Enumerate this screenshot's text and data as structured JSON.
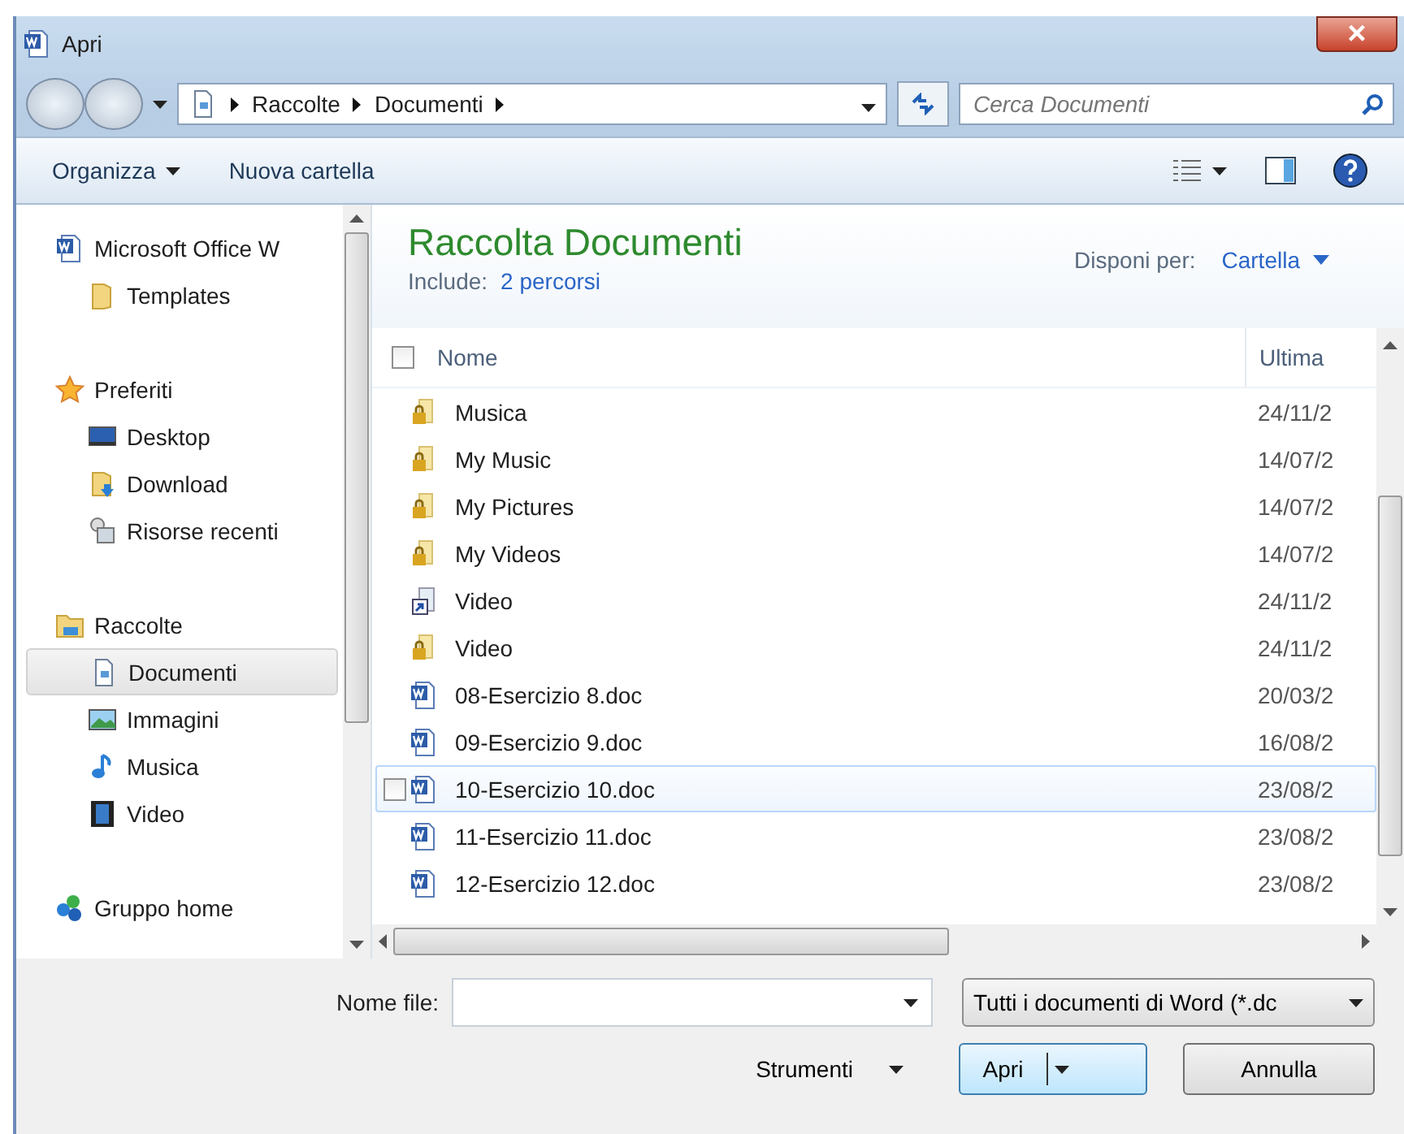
{
  "window": {
    "title": "Apri",
    "close": "×"
  },
  "address": {
    "crumbs": [
      "Raccolte",
      "Documenti"
    ],
    "search_placeholder": "Cerca Documenti"
  },
  "toolbar": {
    "organize": "Organizza",
    "new_folder": "Nuova cartella"
  },
  "sidebar": {
    "groups": [
      {
        "label": "Microsoft Office W",
        "kind": "word",
        "children": [
          {
            "label": "Templates",
            "kind": "folder",
            "selected": false
          }
        ]
      },
      {
        "label": "Preferiti",
        "kind": "star",
        "children": [
          {
            "label": "Desktop",
            "kind": "desktop",
            "selected": false
          },
          {
            "label": "Download",
            "kind": "download",
            "selected": false
          },
          {
            "label": "Risorse recenti",
            "kind": "recent",
            "selected": false
          }
        ]
      },
      {
        "label": "Raccolte",
        "kind": "library",
        "children": [
          {
            "label": "Documenti",
            "kind": "doc",
            "selected": true
          },
          {
            "label": "Immagini",
            "kind": "image",
            "selected": false
          },
          {
            "label": "Musica",
            "kind": "music",
            "selected": false
          },
          {
            "label": "Video",
            "kind": "video",
            "selected": false
          }
        ]
      },
      {
        "label": "Gruppo home",
        "kind": "homegroup"
      }
    ]
  },
  "library": {
    "title": "Raccolta Documenti",
    "include_label": "Include:",
    "include_link": "2 percorsi",
    "arrange_label": "Disponi per:",
    "arrange_value": "Cartella"
  },
  "table": {
    "columns": [
      "Nome",
      "Ultima"
    ],
    "all_checked": false,
    "rows": [
      {
        "name": "Musica",
        "date": "24/11/2",
        "kind": "locked-folder",
        "hover": false
      },
      {
        "name": "My Music",
        "date": "14/07/2",
        "kind": "locked-folder",
        "hover": false
      },
      {
        "name": "My Pictures",
        "date": "14/07/2",
        "kind": "locked-folder",
        "hover": false
      },
      {
        "name": "My Videos",
        "date": "14/07/2",
        "kind": "locked-folder",
        "hover": false
      },
      {
        "name": "Video",
        "date": "24/11/2",
        "kind": "shortcut",
        "hover": false
      },
      {
        "name": "Video",
        "date": "24/11/2",
        "kind": "locked-folder",
        "hover": false
      },
      {
        "name": "08-Esercizio 8.doc",
        "date": "20/03/2",
        "kind": "word",
        "hover": false
      },
      {
        "name": "09-Esercizio 9.doc",
        "date": "16/08/2",
        "kind": "word",
        "hover": false
      },
      {
        "name": "10-Esercizio 10.doc",
        "date": "23/08/2",
        "kind": "word",
        "hover": true,
        "checked": false
      },
      {
        "name": "11-Esercizio 11.doc",
        "date": "23/08/2",
        "kind": "word",
        "hover": false
      },
      {
        "name": "12-Esercizio 12.doc",
        "date": "23/08/2",
        "kind": "word",
        "hover": false
      }
    ]
  },
  "footer": {
    "filename_label": "Nome file:",
    "filter": "Tutti i documenti di Word (*.dc",
    "tools": "Strumenti",
    "open": "Apri",
    "cancel": "Annulla"
  }
}
